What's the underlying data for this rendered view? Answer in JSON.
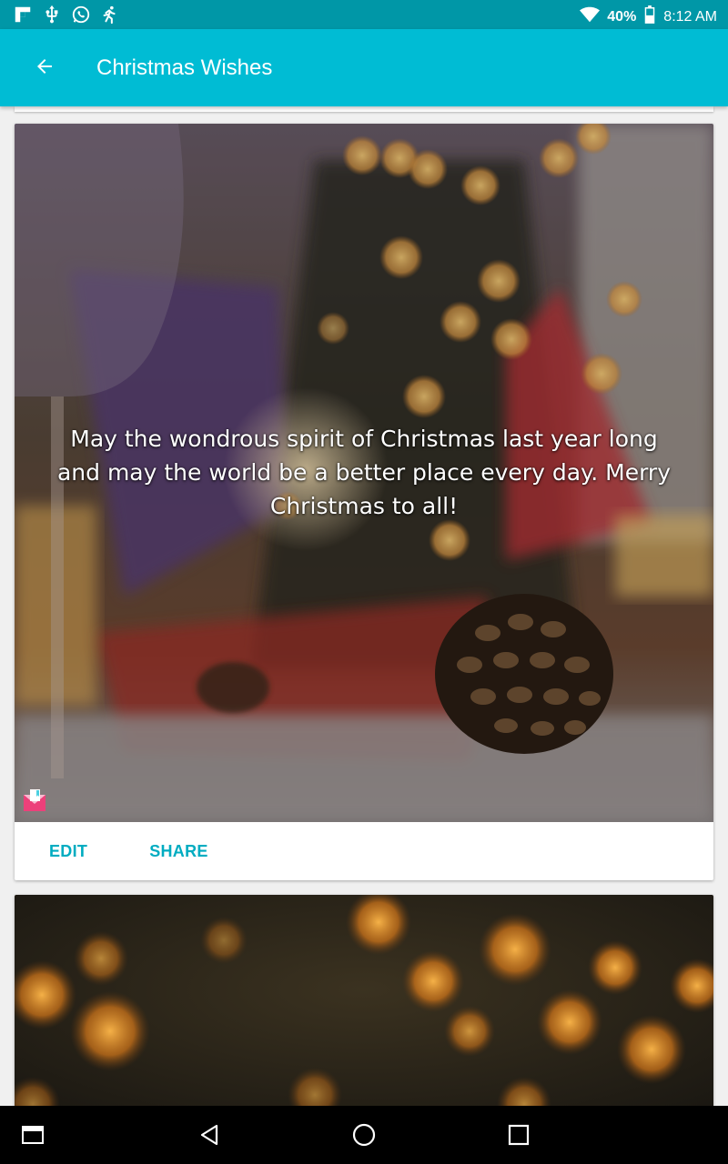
{
  "status_bar": {
    "battery": "40%",
    "time": "8:12 AM",
    "left_icons": [
      "flipboard-icon",
      "usb-icon",
      "whatsapp-icon",
      "running-icon"
    ],
    "right_icons": [
      "wifi-icon",
      "battery-icon"
    ]
  },
  "app_bar": {
    "title": "Christmas Wishes",
    "back_icon": "arrow-back-icon"
  },
  "cards": [
    {
      "quote": "May the wondrous spirit of Christmas last year long and may the world be a better place every day. Merry Christmas to all!",
      "badge_icon": "envelope-badge-icon",
      "actions": {
        "edit_label": "EDIT",
        "share_label": "SHARE"
      }
    }
  ],
  "nav_bar": {
    "icons": [
      "recent-apps-icon",
      "back-triangle-icon",
      "home-circle-icon",
      "overview-square-icon"
    ]
  },
  "colors": {
    "status_bar": "#0097a7",
    "app_bar": "#00bcd4",
    "accent": "#00acc1",
    "nav_bar": "#000000"
  }
}
